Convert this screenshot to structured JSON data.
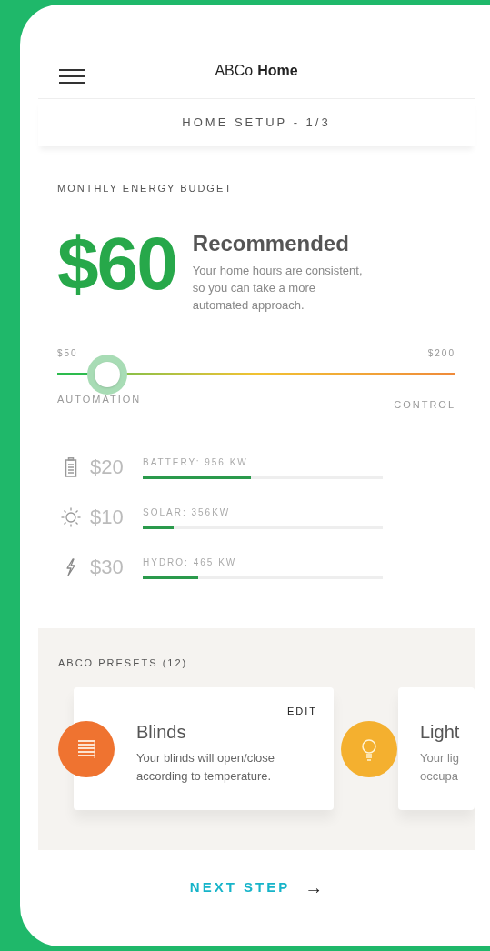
{
  "header": {
    "title_light": "ABCo",
    "title_bold": "Home"
  },
  "step": "HOME SETUP - 1/3",
  "budget": {
    "label": "MONTHLY ENERGY BUDGET",
    "amount": "$60",
    "headline": "Recommended",
    "description": "Your home hours are consistent, so you can take a more automated approach."
  },
  "slider": {
    "min_label": "$50",
    "max_label": "$200",
    "level": 0.126,
    "left_label": "AUTOMATION",
    "right_label": "CONTROL"
  },
  "sources": [
    {
      "kind": "battery",
      "amount": "$20",
      "label": "BATTERY: 956 KW",
      "level": 0.45
    },
    {
      "kind": "solar",
      "amount": "$10",
      "label": "SOLAR: 356KW",
      "level": 0.13
    },
    {
      "kind": "hydro",
      "amount": "$30",
      "label": "HYDRO: 465 KW",
      "level": 0.23
    }
  ],
  "presets": {
    "title": "ABCO PRESETS (12)",
    "cards": [
      {
        "kind": "blinds",
        "color": "#ef7330",
        "title": "Blinds",
        "edit": "EDIT",
        "description": "Your blinds will open/close according to temperature."
      },
      {
        "kind": "lights",
        "color": "#f4b02f",
        "title": "Light",
        "description_lines": [
          "Your lig",
          "occupa"
        ]
      }
    ]
  },
  "next_step": {
    "label": "NEXT STEP",
    "arrow": "→"
  }
}
